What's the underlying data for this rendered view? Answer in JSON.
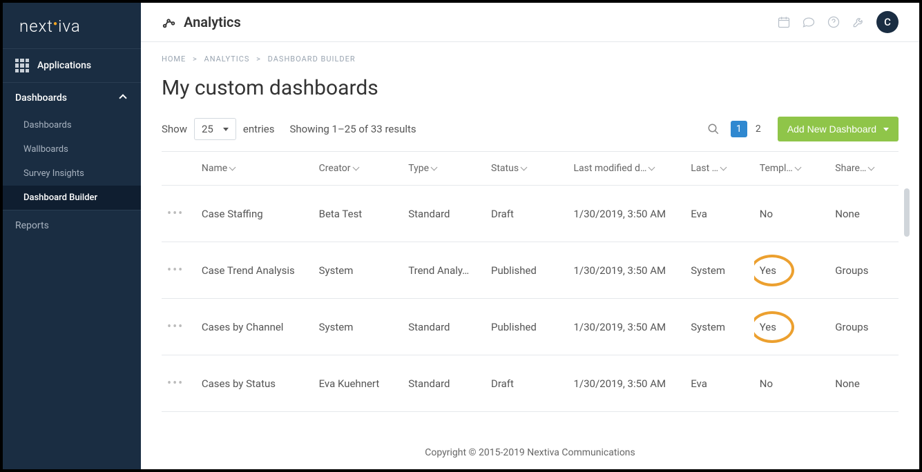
{
  "brand": "nextiva",
  "sidebar": {
    "applications_label": "Applications",
    "dashboards_header": "Dashboards",
    "items": [
      {
        "label": "Dashboards"
      },
      {
        "label": "Wallboards"
      },
      {
        "label": "Survey Insights"
      },
      {
        "label": "Dashboard Builder"
      }
    ],
    "reports_label": "Reports"
  },
  "topbar": {
    "title": "Analytics",
    "avatar": "C"
  },
  "breadcrumb": {
    "home": "HOME",
    "analytics": "ANALYTICS",
    "current": "DASHBOARD BUILDER",
    "sep": ">"
  },
  "page_title": "My custom dashboards",
  "controls": {
    "show_label": "Show",
    "entries_value": "25",
    "entries_label": "entries",
    "results_text": "Showing 1–25 of 33 results",
    "pages": [
      "1",
      "2"
    ],
    "add_button": "Add New Dashboard"
  },
  "table": {
    "headers": {
      "name": "Name",
      "creator": "Creator",
      "type": "Type",
      "status": "Status",
      "modified": "Last modified d…",
      "modified_by": "Last …",
      "template": "Templ…",
      "shared": "Share…"
    },
    "rows": [
      {
        "name": "Case Staffing",
        "creator": "Beta Test",
        "type": "Standard",
        "status": "Draft",
        "modified": "1/30/2019, 3:50 AM",
        "modified_by": "Eva",
        "template": "No",
        "shared": "None",
        "highlight": false
      },
      {
        "name": "Case Trend Analysis",
        "creator": "System",
        "type": "Trend Analy…",
        "status": "Published",
        "modified": "1/30/2019, 3:50 AM",
        "modified_by": "System",
        "template": "Yes",
        "shared": "Groups",
        "highlight": true
      },
      {
        "name": "Cases by Channel",
        "creator": "System",
        "type": "Standard",
        "status": "Published",
        "modified": "1/30/2019, 3:50 AM",
        "modified_by": "System",
        "template": "Yes",
        "shared": "Groups",
        "highlight": true
      },
      {
        "name": "Cases by Status",
        "creator": "Eva Kuehnert",
        "type": "Standard",
        "status": "Draft",
        "modified": "1/30/2019, 3:50 AM",
        "modified_by": "Eva",
        "template": "No",
        "shared": "None",
        "highlight": false
      }
    ]
  },
  "footer": "Copyright © 2015-2019 Nextiva Communications"
}
